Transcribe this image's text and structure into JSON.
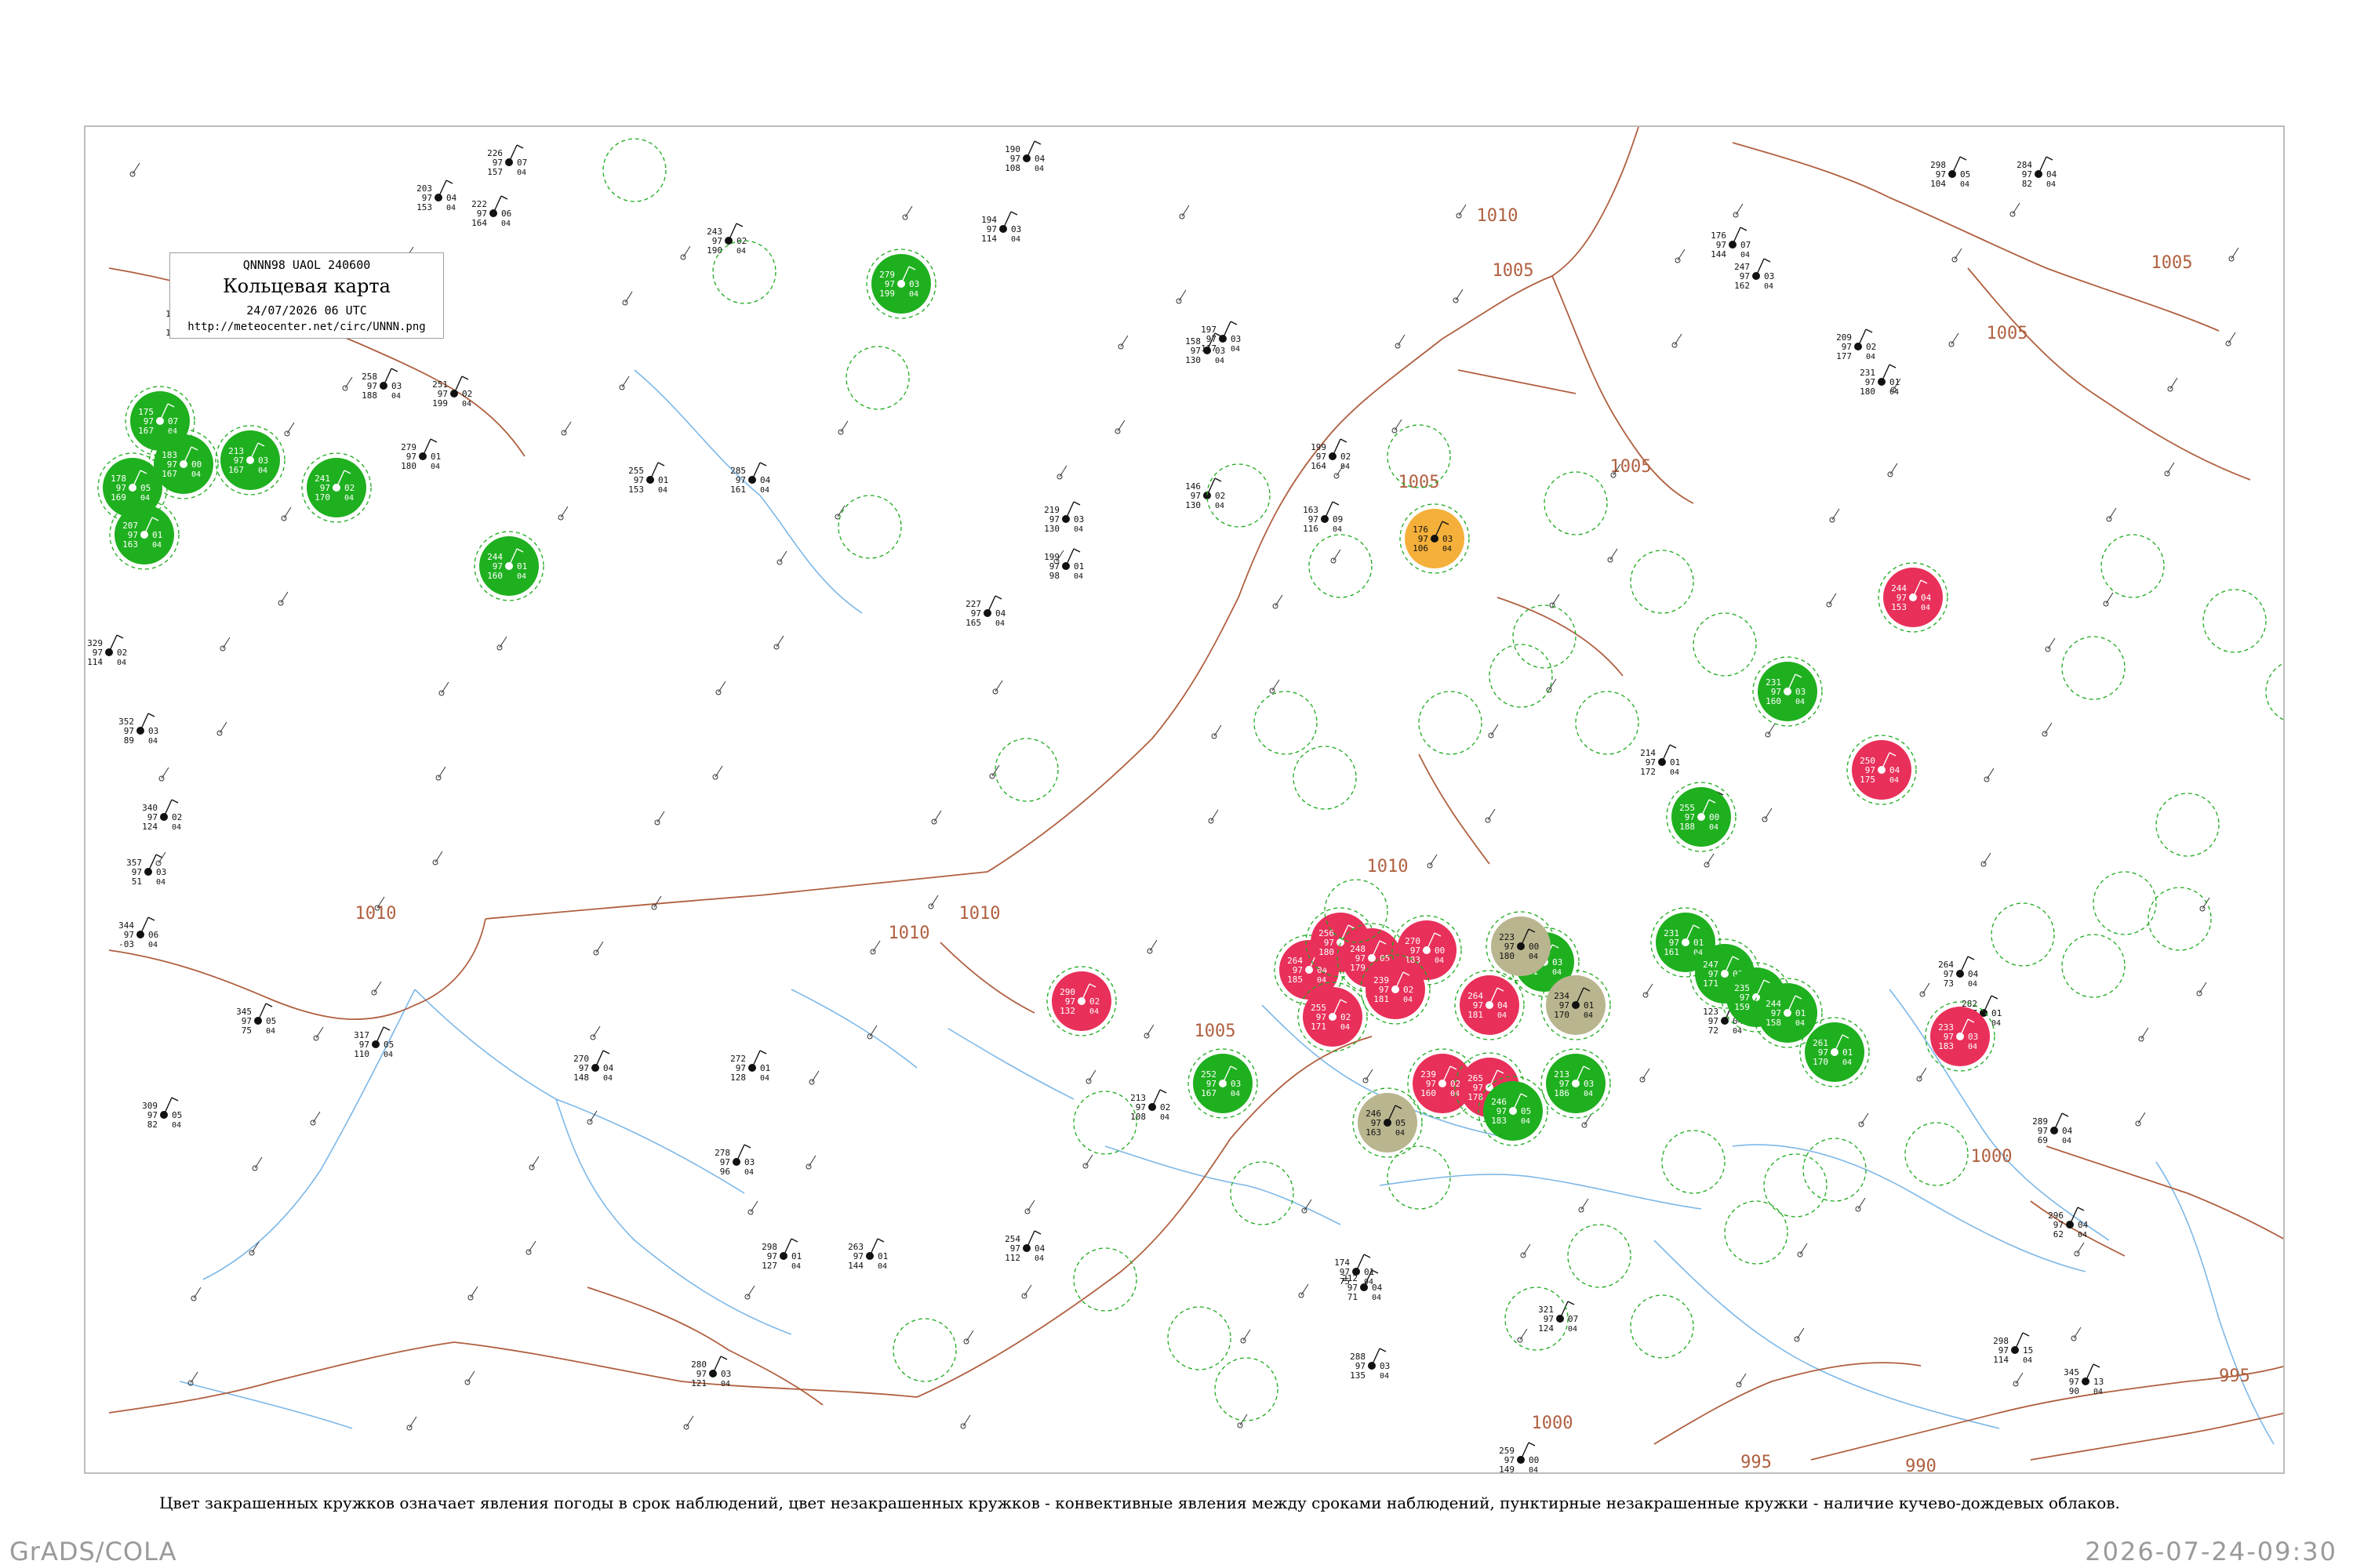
{
  "header": {
    "code": "QNNN98  UAOL  240600",
    "title": "Кольцевая карта",
    "datetime": "24/07/2026 06 UTC",
    "url": "http://meteocenter.net/circ/UNNN.png"
  },
  "caption": "Цвет закрашенных кружков означает явления погоды в срок наблюдений, цвет незакрашенных кружков - конвективные явления между сроками наблюдений, пунктирные незакрашенные кружки - наличие кучево-дождевых облаков.",
  "footer": {
    "software": "GrADS/COLA",
    "timestamp": "2026-07-24-09:30"
  },
  "isobar_labels": [
    "1010",
    "1010",
    "1010",
    "1005",
    "1005",
    "1005",
    "1005",
    "1005",
    "1005",
    "1000",
    "1000",
    "995",
    "995",
    "990",
    "1010",
    "1010"
  ],
  "colors": {
    "thunderstorm": "#e8305a",
    "rain": "#1fb01f",
    "fog_haze": "#b9b58f",
    "dust": "#f4b03a",
    "cb_dashed": "#1faa1f",
    "isobar": "#b06040",
    "river": "#7db8e8"
  },
  "stations": [
    {
      "temp": "178",
      "pres": "97",
      "dew": "169",
      "code": "05",
      "wx": "rain"
    },
    {
      "temp": "175",
      "pres": "97",
      "dew": "167",
      "code": "07",
      "wx": "rain"
    },
    {
      "temp": "183",
      "pres": "97",
      "dew": "167",
      "code": "00",
      "wx": "rain"
    },
    {
      "temp": "213",
      "pres": "97",
      "dew": "167",
      "code": "03",
      "wx": "rain"
    },
    {
      "temp": "207",
      "pres": "97",
      "dew": "163",
      "code": "01",
      "wx": "rain"
    },
    {
      "temp": "241",
      "pres": "97",
      "dew": "170",
      "code": "02",
      "wx": "rain"
    },
    {
      "temp": "279",
      "pres": "97",
      "dew": "199",
      "code": "03",
      "wx": "rain"
    },
    {
      "temp": "244",
      "pres": "97",
      "dew": "160",
      "code": "01",
      "wx": "rain"
    },
    {
      "temp": "290",
      "pres": "97",
      "dew": "132",
      "code": "02",
      "wx": "thunderstorm"
    },
    {
      "temp": "264",
      "pres": "97",
      "dew": "185",
      "code": "04",
      "wx": "thunderstorm"
    },
    {
      "temp": "256",
      "pres": "97",
      "dew": "180",
      "code": "03",
      "wx": "thunderstorm"
    },
    {
      "temp": "248",
      "pres": "97",
      "dew": "179",
      "code": "05",
      "wx": "thunderstorm"
    },
    {
      "temp": "270",
      "pres": "97",
      "dew": "183",
      "code": "00",
      "wx": "thunderstorm"
    },
    {
      "temp": "239",
      "pres": "97",
      "dew": "181",
      "code": "02",
      "wx": "thunderstorm"
    },
    {
      "temp": "255",
      "pres": "97",
      "dew": "171",
      "code": "02",
      "wx": "thunderstorm"
    },
    {
      "temp": "252",
      "pres": "97",
      "dew": "167",
      "code": "03",
      "wx": "rain"
    },
    {
      "temp": "264",
      "pres": "97",
      "dew": "181",
      "code": "04",
      "wx": "thunderstorm"
    },
    {
      "temp": "255",
      "pres": "97",
      "dew": "181",
      "code": "03",
      "wx": "rain"
    },
    {
      "temp": "239",
      "pres": "97",
      "dew": "160",
      "code": "02",
      "wx": "thunderstorm"
    },
    {
      "temp": "265",
      "pres": "97",
      "dew": "178",
      "code": "04",
      "wx": "thunderstorm"
    },
    {
      "temp": "246",
      "pres": "97",
      "dew": "183",
      "code": "05",
      "wx": "rain"
    },
    {
      "temp": "213",
      "pres": "97",
      "dew": "186",
      "code": "03",
      "wx": "rain"
    },
    {
      "temp": "176",
      "pres": "97",
      "dew": "106",
      "code": "03",
      "wx": "dust"
    },
    {
      "temp": "246",
      "pres": "97",
      "dew": "163",
      "code": "05",
      "wx": "fog_haze"
    },
    {
      "temp": "234",
      "pres": "97",
      "dew": "170",
      "code": "01",
      "wx": "fog_haze"
    },
    {
      "temp": "223",
      "pres": "97",
      "dew": "180",
      "code": "00",
      "wx": "fog_haze"
    },
    {
      "temp": "231",
      "pres": "97",
      "dew": "161",
      "code": "01",
      "wx": "rain"
    },
    {
      "temp": "247",
      "pres": "97",
      "dew": "171",
      "code": "03",
      "wx": "rain"
    },
    {
      "temp": "235",
      "pres": "97",
      "dew": "159",
      "code": "04",
      "wx": "rain"
    },
    {
      "temp": "244",
      "pres": "97",
      "dew": "158",
      "code": "01",
      "wx": "rain"
    },
    {
      "temp": "261",
      "pres": "97",
      "dew": "170",
      "code": "01",
      "wx": "rain"
    },
    {
      "temp": "233",
      "pres": "97",
      "dew": "183",
      "code": "03",
      "wx": "thunderstorm"
    },
    {
      "temp": "250",
      "pres": "97",
      "dew": "175",
      "code": "04",
      "wx": "thunderstorm"
    },
    {
      "temp": "244",
      "pres": "97",
      "dew": "153",
      "code": "04",
      "wx": "thunderstorm"
    },
    {
      "temp": "231",
      "pres": "97",
      "dew": "160",
      "code": "03",
      "wx": "rain"
    },
    {
      "temp": "255",
      "pres": "97",
      "dew": "188",
      "code": "00",
      "wx": "rain"
    }
  ],
  "plain_stations": [
    {
      "temp": "226",
      "pres": "97",
      "dew": "157",
      "code": "07"
    },
    {
      "temp": "203",
      "pres": "97",
      "dew": "153",
      "code": "04"
    },
    {
      "temp": "222",
      "pres": "97",
      "dew": "164",
      "code": "06"
    },
    {
      "temp": "190",
      "pres": "97",
      "dew": "108",
      "code": "04"
    },
    {
      "temp": "243",
      "pres": "97",
      "dew": "190",
      "code": "02"
    },
    {
      "temp": "194",
      "pres": "97",
      "dew": "114",
      "code": "03"
    },
    {
      "temp": "158",
      "pres": "97",
      "dew": "130",
      "code": "03"
    },
    {
      "temp": "197",
      "pres": "97",
      "dew": "117",
      "code": "03"
    },
    {
      "temp": "176",
      "pres": "97",
      "dew": "144",
      "code": "07"
    },
    {
      "temp": "247",
      "pres": "97",
      "dew": "162",
      "code": "03"
    },
    {
      "temp": "298",
      "pres": "97",
      "dew": "104",
      "code": "05"
    },
    {
      "temp": "284",
      "pres": "97",
      "dew": "82",
      "code": "04"
    },
    {
      "temp": "209",
      "pres": "97",
      "dew": "177",
      "code": "02"
    },
    {
      "temp": "231",
      "pres": "97",
      "dew": "180",
      "code": "01"
    },
    {
      "temp": "188",
      "pres": "97",
      "dew": "150",
      "code": "01"
    },
    {
      "temp": "187",
      "pres": "97",
      "dew": "150",
      "code": "05"
    },
    {
      "temp": "235",
      "pres": "97",
      "dew": "161",
      "code": "01"
    },
    {
      "temp": "258",
      "pres": "97",
      "dew": "188",
      "code": "03"
    },
    {
      "temp": "251",
      "pres": "97",
      "dew": "199",
      "code": "02"
    },
    {
      "temp": "279",
      "pres": "97",
      "dew": "180",
      "code": "01"
    },
    {
      "temp": "285",
      "pres": "97",
      "dew": "161",
      "code": "04"
    },
    {
      "temp": "255",
      "pres": "97",
      "dew": "153",
      "code": "01"
    },
    {
      "temp": "219",
      "pres": "97",
      "dew": "130",
      "code": "03"
    },
    {
      "temp": "199",
      "pres": "97",
      "dew": "98",
      "code": "01"
    },
    {
      "temp": "146",
      "pres": "97",
      "dew": "130",
      "code": "02"
    },
    {
      "temp": "163",
      "pres": "97",
      "dew": "116",
      "code": "09"
    },
    {
      "temp": "199",
      "pres": "97",
      "dew": "164",
      "code": "02"
    },
    {
      "temp": "227",
      "pres": "97",
      "dew": "165",
      "code": "04"
    },
    {
      "temp": "329",
      "pres": "97",
      "dew": "114",
      "code": "02"
    },
    {
      "temp": "352",
      "pres": "97",
      "dew": "89",
      "code": "03"
    },
    {
      "temp": "340",
      "pres": "97",
      "dew": "124",
      "code": "02"
    },
    {
      "temp": "357",
      "pres": "97",
      "dew": "51",
      "code": "03"
    },
    {
      "temp": "344",
      "pres": "97",
      "dew": "-03",
      "code": "06"
    },
    {
      "temp": "345",
      "pres": "97",
      "dew": "75",
      "code": "05"
    },
    {
      "temp": "317",
      "pres": "97",
      "dew": "110",
      "code": "05"
    },
    {
      "temp": "272",
      "pres": "97",
      "dew": "128",
      "code": "01"
    },
    {
      "temp": "270",
      "pres": "97",
      "dew": "148",
      "code": "04"
    },
    {
      "temp": "278",
      "pres": "97",
      "dew": "96",
      "code": "03"
    },
    {
      "temp": "298",
      "pres": "97",
      "dew": "127",
      "code": "01"
    },
    {
      "temp": "280",
      "pres": "97",
      "dew": "121",
      "code": "03"
    },
    {
      "temp": "309",
      "pres": "97",
      "dew": "82",
      "code": "05"
    },
    {
      "temp": "345",
      "pres": "97",
      "dew": "90",
      "code": "13"
    },
    {
      "temp": "321",
      "pres": "97",
      "dew": "124",
      "code": "07"
    },
    {
      "temp": "288",
      "pres": "97",
      "dew": "135",
      "code": "03"
    },
    {
      "temp": "289",
      "pres": "97",
      "dew": "69",
      "code": "04"
    },
    {
      "temp": "296",
      "pres": "97",
      "dew": "62",
      "code": "04"
    },
    {
      "temp": "282",
      "pres": "97",
      "dew": "88",
      "code": "01"
    },
    {
      "temp": "264",
      "pres": "97",
      "dew": "73",
      "code": "04"
    },
    {
      "temp": "123",
      "pres": "97",
      "dew": "72",
      "code": "04"
    },
    {
      "temp": "152",
      "pres": "97",
      "dew": "118",
      "code": "04"
    },
    {
      "temp": "214",
      "pres": "97",
      "dew": "172",
      "code": "01"
    },
    {
      "temp": "263",
      "pres": "97",
      "dew": "144",
      "code": "01"
    },
    {
      "temp": "259",
      "pres": "97",
      "dew": "149",
      "code": "00"
    },
    {
      "temp": "213",
      "pres": "97",
      "dew": "108",
      "code": "02"
    },
    {
      "temp": "212",
      "pres": "97",
      "dew": "71",
      "code": "04"
    },
    {
      "temp": "254",
      "pres": "97",
      "dew": "112",
      "code": "04"
    },
    {
      "temp": "174",
      "pres": "97",
      "dew": "75",
      "code": "01"
    },
    {
      "temp": "298",
      "pres": "97",
      "dew": "114",
      "code": "15"
    }
  ]
}
